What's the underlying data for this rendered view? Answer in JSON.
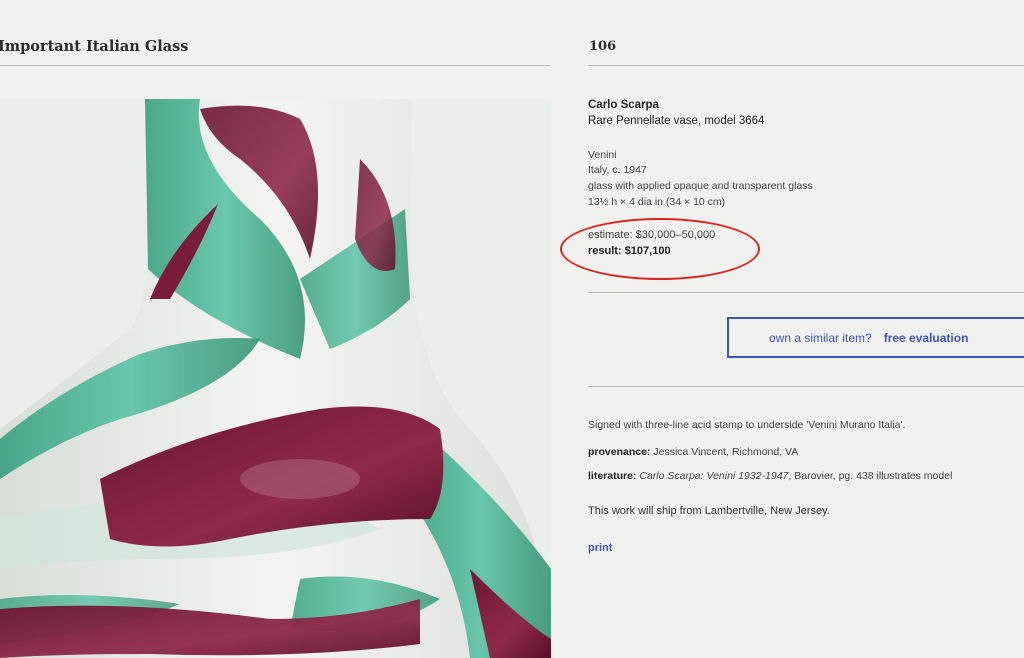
{
  "header": {
    "sale_title": "Important Italian Glass",
    "lot_number": "106"
  },
  "image": {
    "alt": "Rare Pennellate vase",
    "icon": "vase-photo"
  },
  "lot": {
    "artist": "Carlo Scarpa",
    "title": "Rare Pennellate vase, model 3664",
    "maker": "Venini",
    "origin_date": "Italy, c. 1947",
    "medium": "glass with applied opaque and transparent glass",
    "dimensions": "13½ h × 4 dia in (34 × 10 cm)",
    "estimate": "estimate: $30,000–50,000",
    "result_label": "result:",
    "result_value": "$107,100"
  },
  "evaluation": {
    "question": "own a similar item?",
    "cta": "free evaluation"
  },
  "description": {
    "signed": "Signed with three-line acid stamp to underside 'Venini Murano Italia'.",
    "provenance_label": "provenance:",
    "provenance_value": "Jessica Vincent, Richmond, VA",
    "literature_label": "literature:",
    "literature_title": "Carlo Scarpa: Venini 1932-1947",
    "literature_rest": ", Barovier, pg. 438 illustrates model",
    "shipping": "This work will ship from Lambertville, New Jersey."
  },
  "actions": {
    "print": "print"
  },
  "colors": {
    "accent": "#3d52c4",
    "highlight": "#d9231c",
    "background": "#f1f1f0",
    "teal": "#3fae8c",
    "plum": "#7e1d3a"
  }
}
